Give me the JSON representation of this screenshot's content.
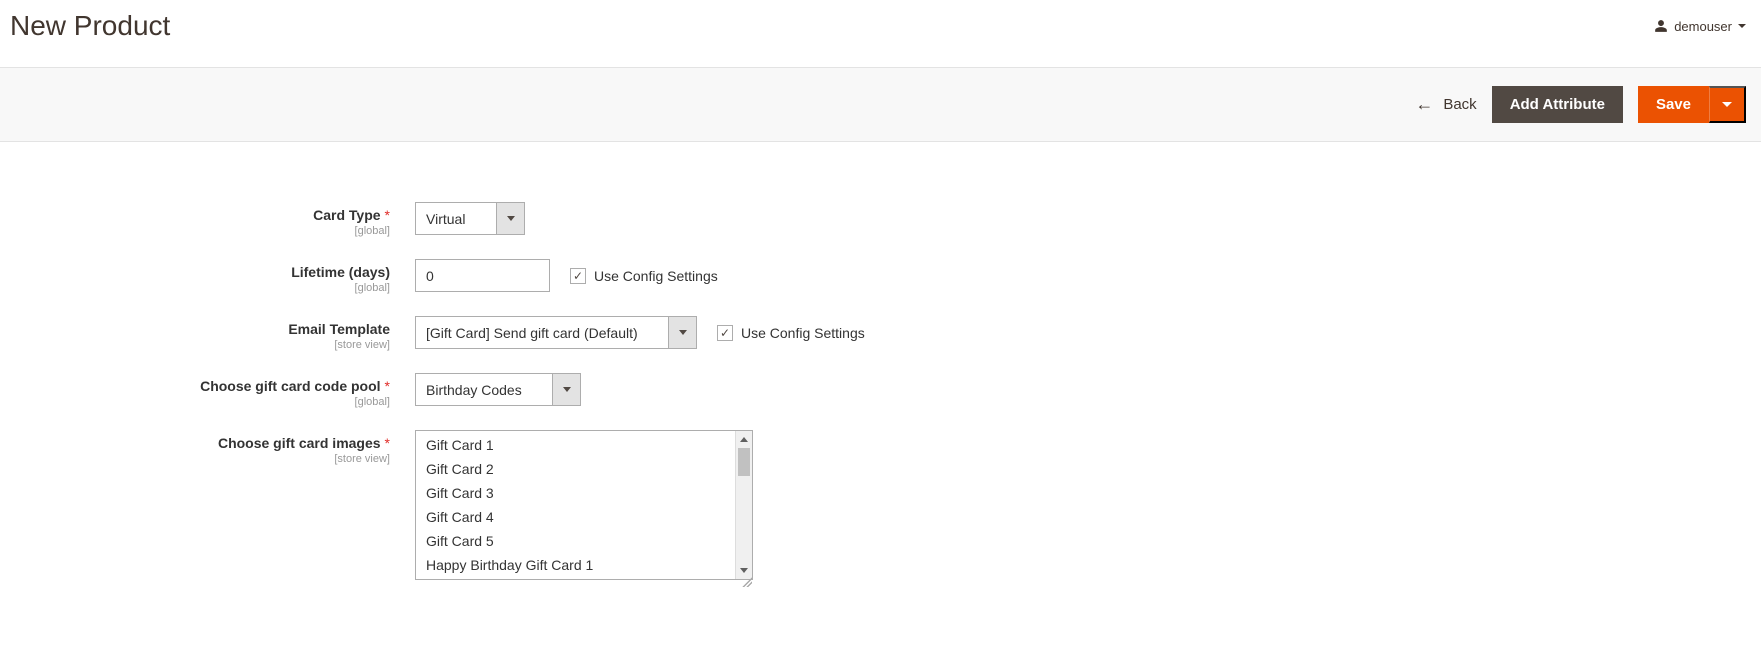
{
  "header": {
    "title": "New Product",
    "user": "demouser"
  },
  "actions": {
    "back": "Back",
    "add_attribute": "Add Attribute",
    "save": "Save"
  },
  "fields": {
    "card_type": {
      "label": "Card Type",
      "scope": "[global]",
      "value": "Virtual"
    },
    "lifetime": {
      "label": "Lifetime (days)",
      "scope": "[global]",
      "value": "0",
      "use_config": "Use Config Settings"
    },
    "email_template": {
      "label": "Email Template",
      "scope": "[store view]",
      "value": "[Gift Card] Send gift card (Default)",
      "use_config": "Use Config Settings"
    },
    "code_pool": {
      "label": "Choose gift card code pool",
      "scope": "[global]",
      "value": "Birthday Codes"
    },
    "images": {
      "label": "Choose gift card images",
      "scope": "[store view]",
      "options": [
        "Gift Card 1",
        "Gift Card 2",
        "Gift Card 3",
        "Gift Card 4",
        "Gift Card 5",
        "Happy Birthday Gift Card 1"
      ]
    }
  }
}
